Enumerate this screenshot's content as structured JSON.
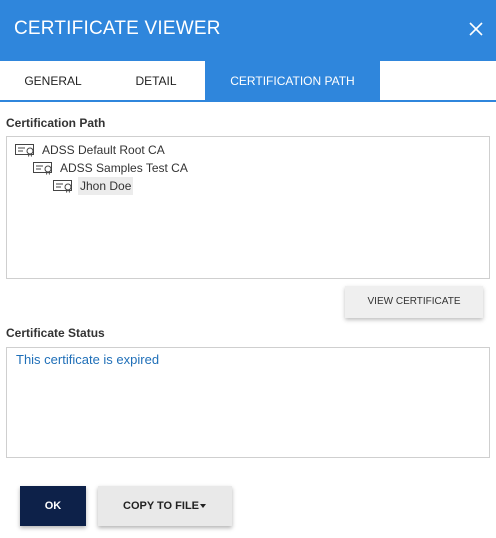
{
  "dialog": {
    "title": "CERTIFICATE VIEWER",
    "close_icon": "close-icon"
  },
  "tabs": [
    {
      "label": "GENERAL",
      "active": false
    },
    {
      "label": "DETAIL",
      "active": false
    },
    {
      "label": "CERTIFICATION PATH",
      "active": true
    }
  ],
  "path_section": {
    "label": "Certification Path",
    "items": [
      {
        "label": "ADSS Default Root CA",
        "icon": "certificate-icon",
        "level": 0,
        "selected": false
      },
      {
        "label": "ADSS Samples Test CA",
        "icon": "certificate-icon",
        "level": 1,
        "selected": false
      },
      {
        "label": "Jhon Doe",
        "icon": "certificate-icon",
        "level": 2,
        "selected": true
      }
    ],
    "view_button": "VIEW CERTIFICATE"
  },
  "status_section": {
    "label": "Certificate Status",
    "text": "This certificate is expired"
  },
  "footer": {
    "ok_label": "OK",
    "copy_label": "COPY TO FILE",
    "copy_icon": "caret-down-icon"
  },
  "colors": {
    "accent": "#2f86dc",
    "ok_button": "#0d2149",
    "status_text": "#1f6fb8"
  }
}
